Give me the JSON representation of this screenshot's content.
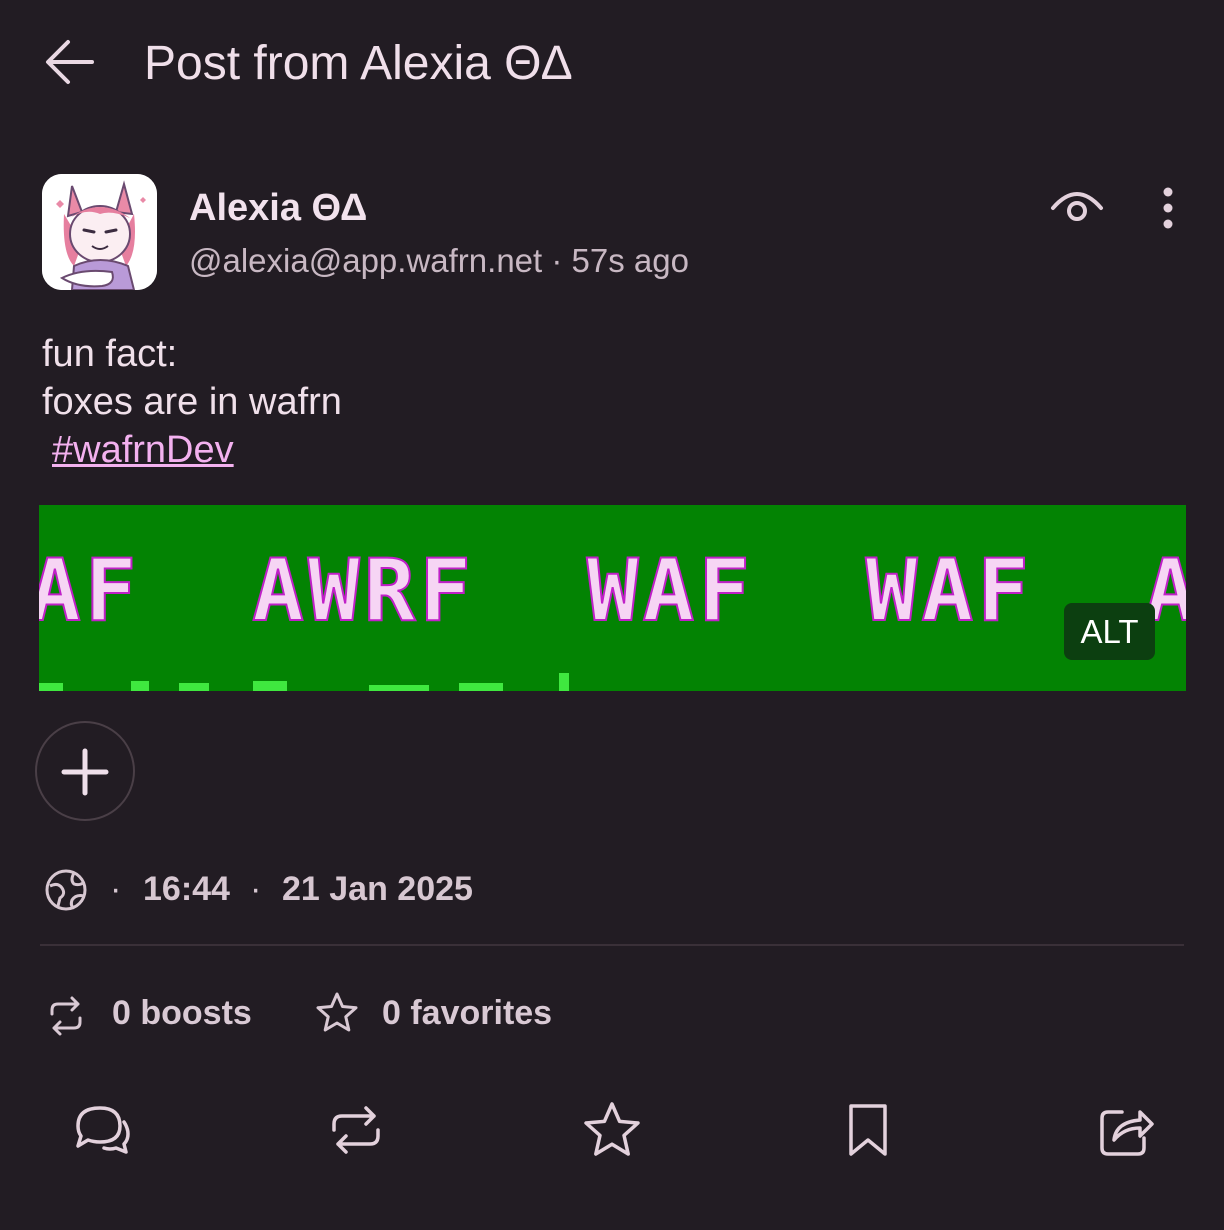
{
  "header": {
    "title": "Post from Alexia ΘΔ"
  },
  "post": {
    "author_name": "Alexia ΘΔ",
    "handle_line": "@alexia@app.wafrn.net · 57s ago",
    "text_lines": [
      "fun fact:",
      "foxes are in wafrn"
    ],
    "hashtag": "#wafrnDev",
    "media": {
      "text": "AF  AWRF  WAF  WAF  AWFRW",
      "alt_label": "ALT"
    },
    "time": "16:44",
    "date": "21 Jan 2025",
    "separator": "·",
    "boosts": "0 boosts",
    "favorites": "0 favorites"
  },
  "colors": {
    "background": "#221c23",
    "text": "#efdfea",
    "hashtag": "#f3b1ef",
    "media_bg": "#038303"
  }
}
